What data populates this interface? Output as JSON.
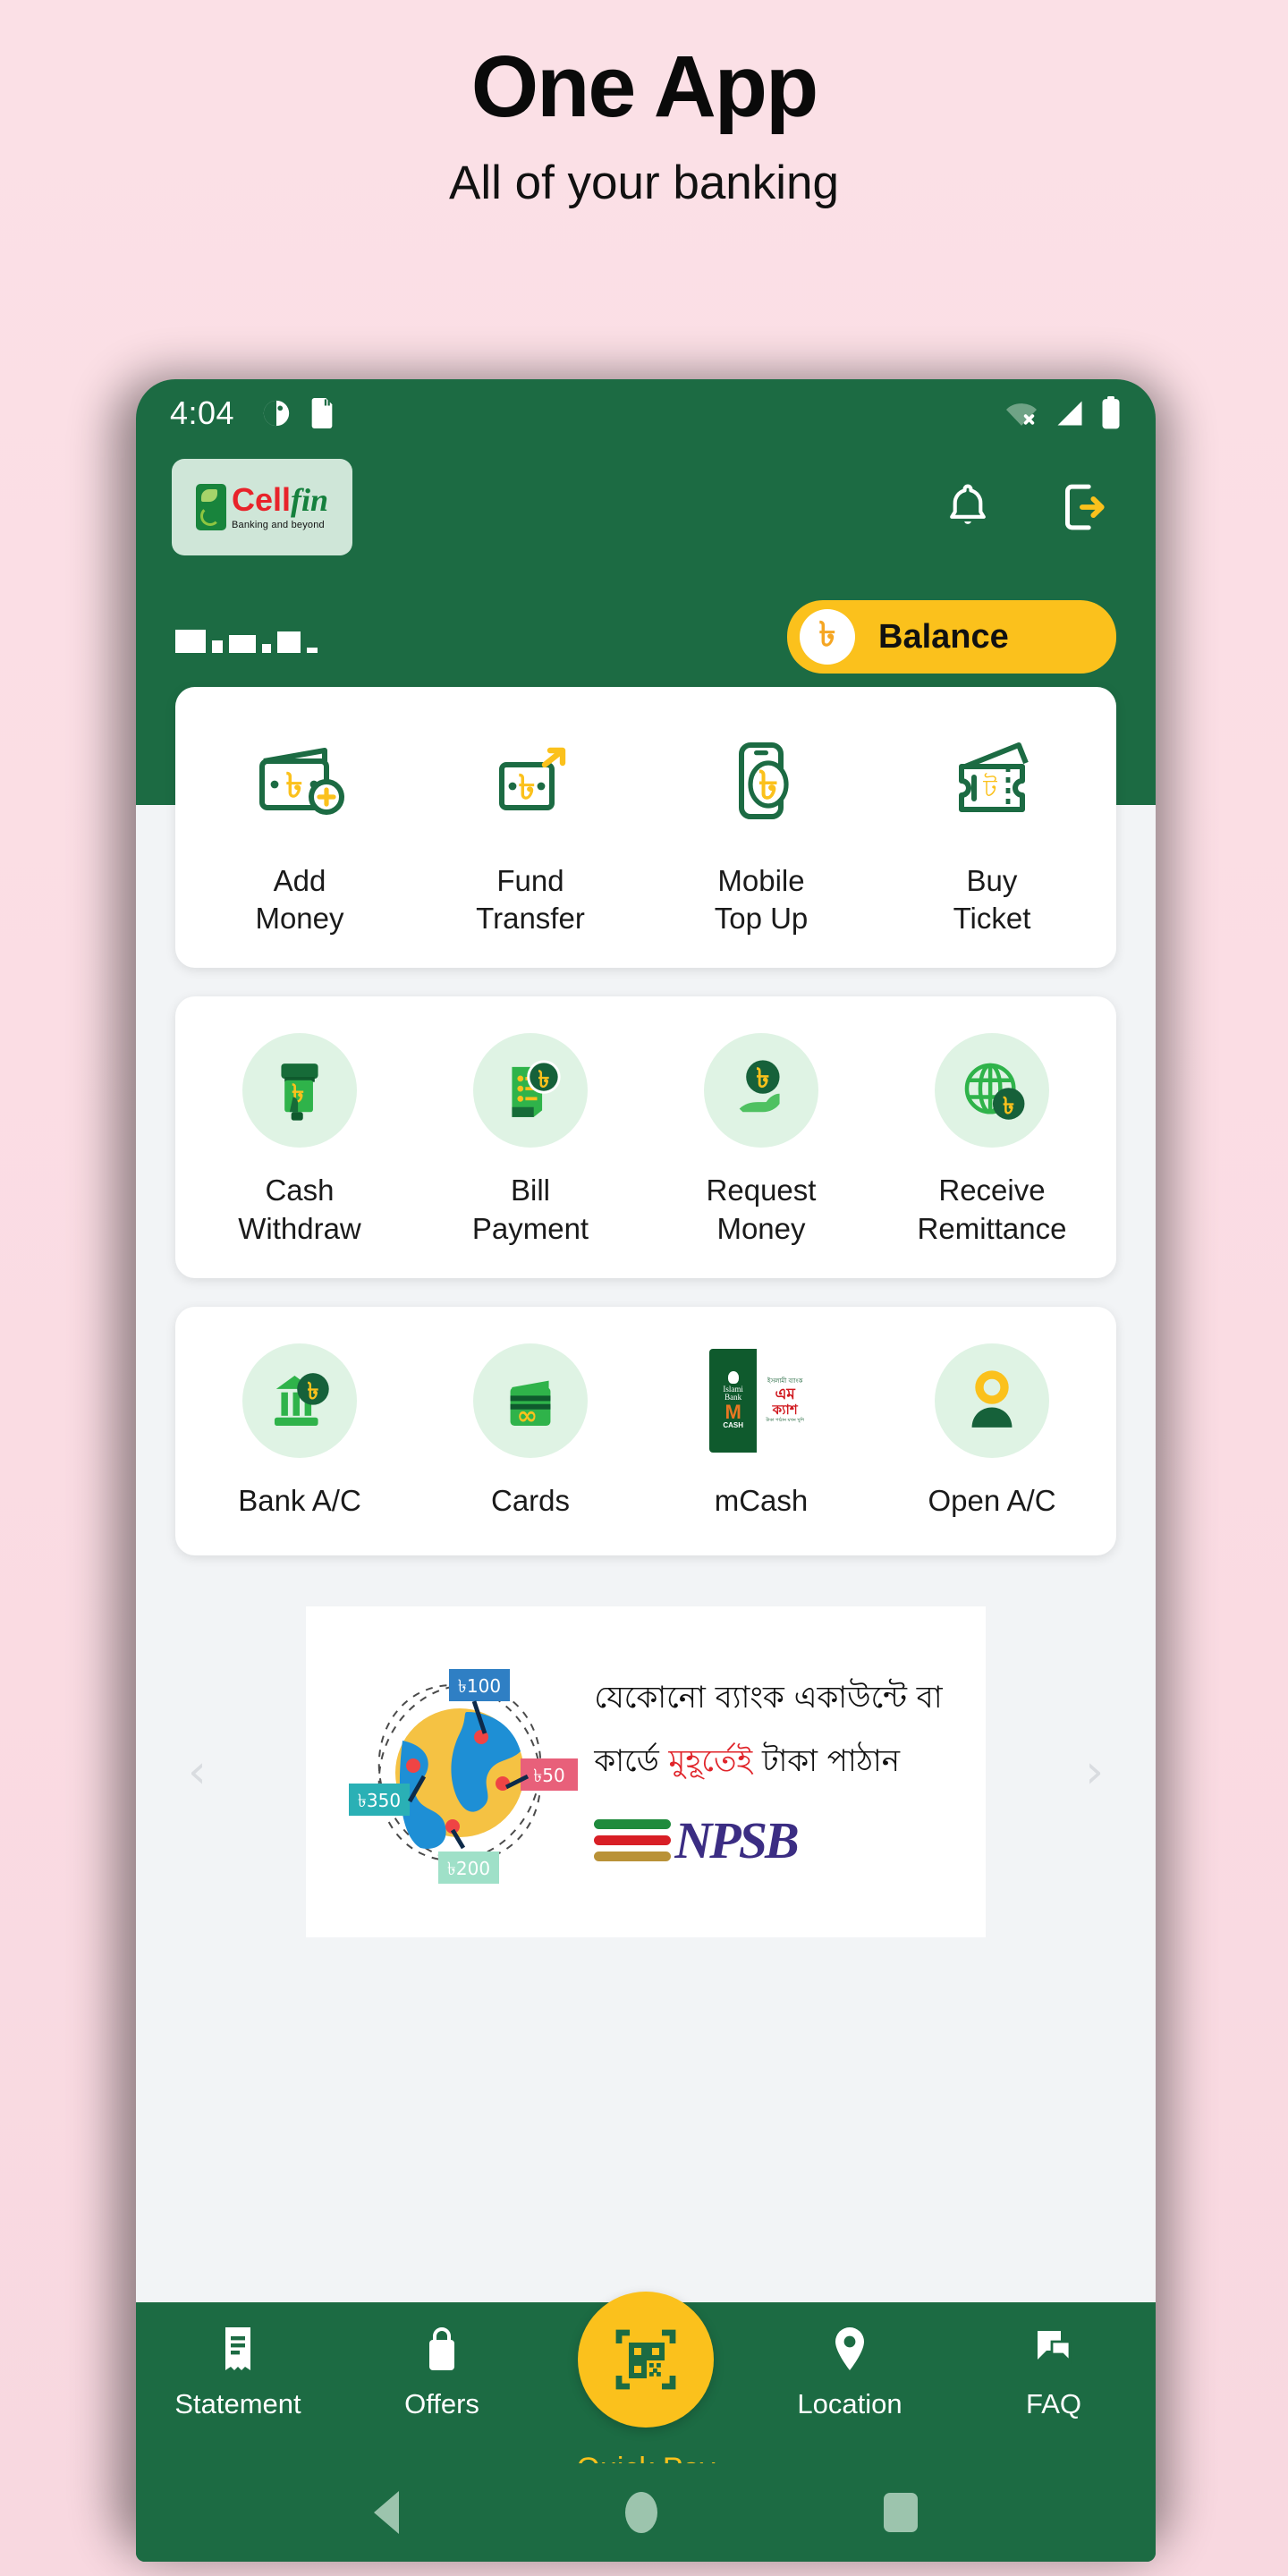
{
  "promo": {
    "title": "One App",
    "subtitle": "All of your banking"
  },
  "statusbar": {
    "time": "4:04",
    "icons": [
      "do-not-disturb-icon",
      "sd-card-icon"
    ],
    "right_icons": [
      "wifi-off-icon",
      "cellular-signal-icon",
      "battery-full-icon"
    ]
  },
  "appbar": {
    "logo": {
      "cell": "Cell",
      "fin": "fin",
      "tagline": "Banking and beyond"
    },
    "notification_icon": "bell-icon",
    "logout_icon": "logout-icon"
  },
  "account": {
    "username_masked": "██ ██ ██ -",
    "balance": {
      "currency_symbol": "৳",
      "label": "Balance"
    }
  },
  "services": {
    "row1": [
      {
        "label": "Add\nMoney",
        "icon": "wallet-add-money-icon"
      },
      {
        "label": "Fund\nTransfer",
        "icon": "money-transfer-arrow-icon"
      },
      {
        "label": "Mobile\nTop Up",
        "icon": "mobile-topup-icon"
      },
      {
        "label": "Buy\nTicket",
        "icon": "ticket-icon"
      }
    ],
    "row2": [
      {
        "label": "Cash\nWithdraw",
        "icon": "atm-cash-withdraw-icon"
      },
      {
        "label": "Bill\nPayment",
        "icon": "bill-payment-icon"
      },
      {
        "label": "Request\nMoney",
        "icon": "request-money-hand-icon"
      },
      {
        "label": "Receive\nRemittance",
        "icon": "globe-remittance-icon"
      }
    ],
    "row3": [
      {
        "label": "Bank A/C",
        "icon": "bank-account-icon"
      },
      {
        "label": "Cards",
        "icon": "credit-card-icon"
      },
      {
        "label": "mCash",
        "icon": "mcash-logo-icon"
      },
      {
        "label": "Open A/C",
        "icon": "open-account-person-icon"
      }
    ]
  },
  "banner": {
    "line1": "যেকোনো ব্যাংক একাউন্টে বা",
    "line2_part1": "কার্ডে ",
    "line2_highlight": "মুহূর্তেই",
    "line2_part2": " টাকা পাঠান",
    "logo_text": "NPSB",
    "badges": [
      "৳100",
      "৳50",
      "৳350",
      "৳200"
    ],
    "prev_arrow": "‹",
    "next_arrow": "›"
  },
  "bottomnav": {
    "items": [
      {
        "label": "Statement",
        "icon": "statement-receipt-icon",
        "active": false
      },
      {
        "label": "Offers",
        "icon": "offers-bag-icon",
        "active": false
      },
      {
        "label": "Location",
        "icon": "location-pin-icon",
        "active": false
      },
      {
        "label": "FAQ",
        "icon": "faq-chat-icon",
        "active": false
      }
    ],
    "fab": {
      "label": "Quick Pay",
      "icon": "qr-code-icon"
    }
  },
  "androidnav": {
    "back": "back-triangle-icon",
    "home": "home-circle-icon",
    "recents": "recents-square-icon"
  },
  "colors": {
    "brand_green": "#1c6b43",
    "accent_yellow": "#fbc11c",
    "icon_mint": "#dff3e4",
    "page_bg": "#fbe0e6",
    "logo_red": "#e8232a"
  }
}
